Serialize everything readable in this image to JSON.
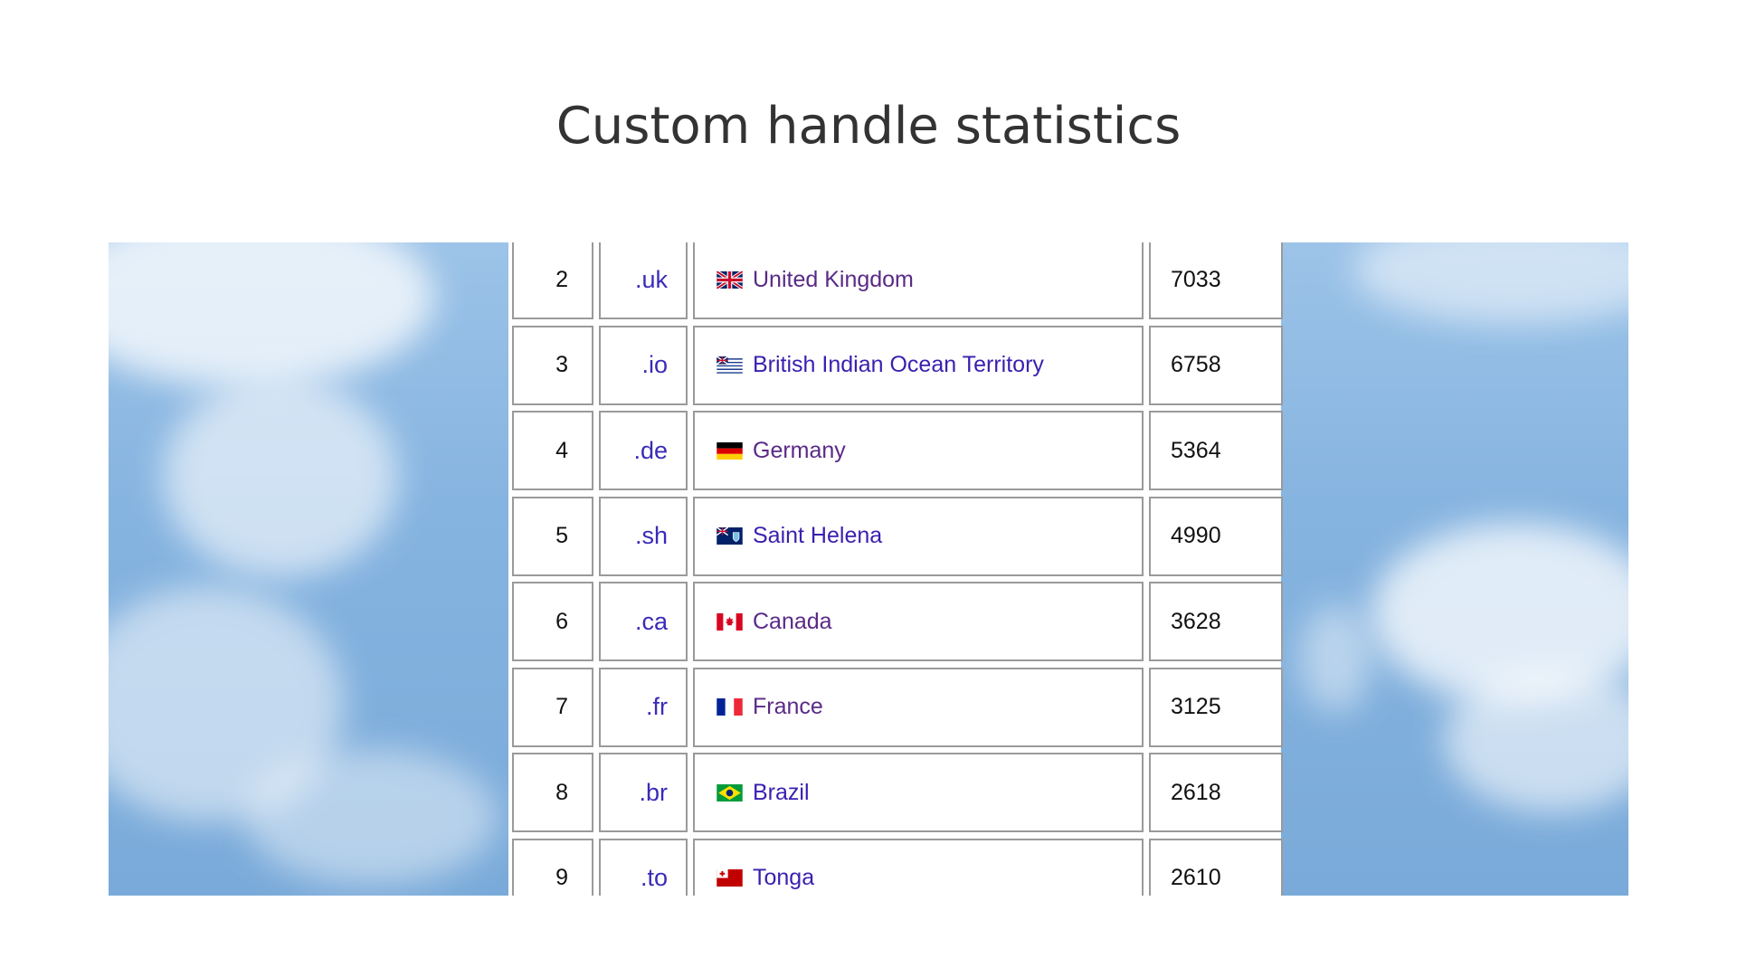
{
  "slide": {
    "title": "Custom handle statistics"
  },
  "table": {
    "rows": [
      {
        "rank": "2",
        "tld": ".uk",
        "country": "United Kingdom",
        "count": "7033",
        "flag": "flag-uk-icon",
        "visited": true
      },
      {
        "rank": "3",
        "tld": ".io",
        "country": "British Indian Ocean Territory",
        "count": "6758",
        "flag": "flag-io-icon",
        "visited": false
      },
      {
        "rank": "4",
        "tld": ".de",
        "country": "Germany",
        "count": "5364",
        "flag": "flag-de-icon",
        "visited": true
      },
      {
        "rank": "5",
        "tld": ".sh",
        "country": "Saint Helena",
        "count": "4990",
        "flag": "flag-sh-icon",
        "visited": false
      },
      {
        "rank": "6",
        "tld": ".ca",
        "country": "Canada",
        "count": "3628",
        "flag": "flag-ca-icon",
        "visited": true
      },
      {
        "rank": "7",
        "tld": ".fr",
        "country": "France",
        "count": "3125",
        "flag": "flag-fr-icon",
        "visited": true
      },
      {
        "rank": "8",
        "tld": ".br",
        "country": "Brazil",
        "count": "2618",
        "flag": "flag-br-icon",
        "visited": false
      },
      {
        "rank": "9",
        "tld": ".to",
        "country": "Tonga",
        "count": "2610",
        "flag": "flag-to-icon",
        "visited": false
      }
    ]
  },
  "colors": {
    "link": "#3a1fb0",
    "visited_link": "#5a2a86",
    "cell_border": "#9a9a9a",
    "sky": "#86b4e0"
  }
}
